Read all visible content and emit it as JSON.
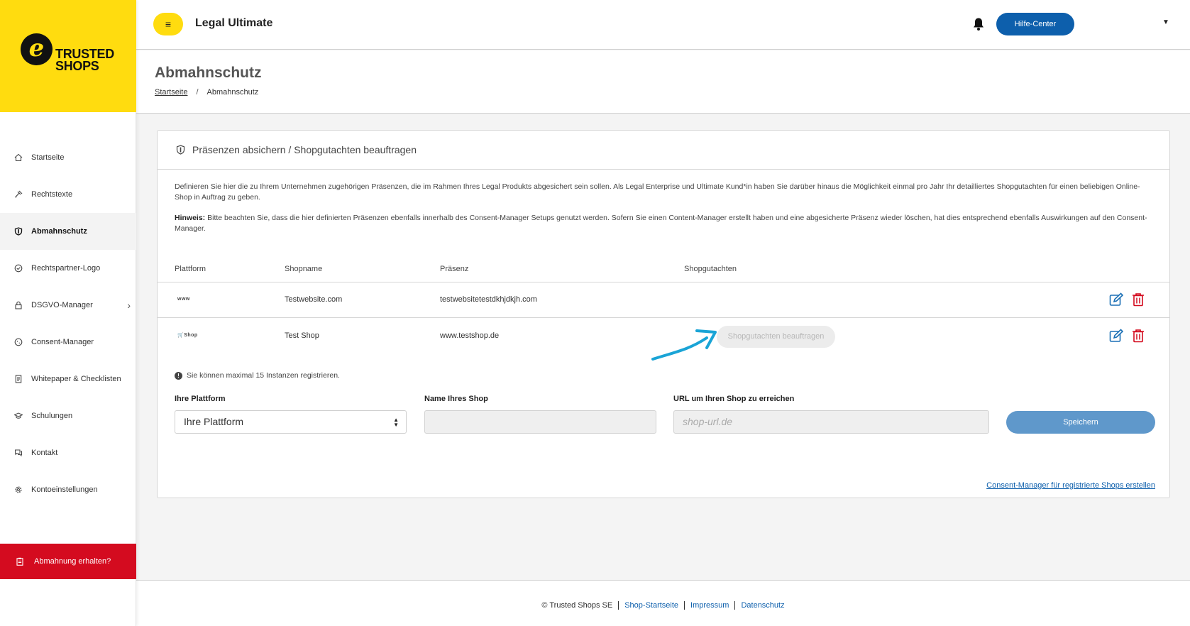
{
  "brand": {
    "logo_line1": "TRUSTED",
    "logo_line2": "SHOPS",
    "logo_mark": "e"
  },
  "sidebar": {
    "items": [
      {
        "label": "Startseite",
        "icon": "home-icon"
      },
      {
        "label": "Rechtstexte",
        "icon": "gavel-icon"
      },
      {
        "label": "Abmahnschutz",
        "icon": "shield-icon",
        "active": true
      },
      {
        "label": "Rechtspartner-Logo",
        "icon": "badge-check-icon"
      },
      {
        "label": "DSGVO-Manager",
        "icon": "lock-icon",
        "has_submenu": true
      },
      {
        "label": "Consent-Manager",
        "icon": "cookie-icon"
      },
      {
        "label": "Whitepaper & Checklisten",
        "icon": "document-icon"
      },
      {
        "label": "Schulungen",
        "icon": "graduation-cap-icon"
      },
      {
        "label": "Kontakt",
        "icon": "chat-icon"
      },
      {
        "label": "Kontoeinstellungen",
        "icon": "gear-icon"
      }
    ],
    "alert_button": "Abmahnung erhalten?"
  },
  "header": {
    "menu_icon": "≡",
    "title": "Legal Ultimate",
    "help_button": "Hilfe-Center"
  },
  "page": {
    "title": "Abmahnschutz",
    "breadcrumb": {
      "home": "Startseite",
      "separator": "/",
      "current": "Abmahnschutz"
    }
  },
  "card": {
    "title": "Präsenzen absichern / Shopgutachten beauftragen",
    "description": "Definieren Sie hier die zu Ihrem Unternehmen zugehörigen Präsenzen, die im Rahmen Ihres Legal Produkts abgesichert sein sollen. Als Legal Enterprise und Ultimate Kund*in haben Sie darüber hinaus die Möglichkeit einmal pro Jahr Ihr detailliertes Shopgutachten für einen beliebigen Online-Shop in Auftrag zu geben.",
    "hint_label": "Hinweis:",
    "hint_text": " Bitte beachten Sie, dass die hier definierten Präsenzen ebenfalls innerhalb des Consent-Manager Setups genutzt werden. Sofern Sie einen Content-Manager erstellt haben und eine abgesicherte Präsenz wieder löschen, hat dies entsprechend ebenfalls Auswirkungen auf den Consent-Manager.",
    "table": {
      "headers": {
        "platform": "Plattform",
        "shopname": "Shopname",
        "presence": "Präsenz",
        "review": "Shopgutachten"
      },
      "rows": [
        {
          "platform": "www",
          "shopname": "Testwebsite.com",
          "presence": "testwebsitetestdkhjdkjh.com",
          "review_button": ""
        },
        {
          "platform": "🛒Shop",
          "shopname": "Test Shop",
          "presence": "www.testshop.de",
          "review_button": "Shopgutachten beauftragen"
        }
      ]
    },
    "limit_note": "Sie können maximal 15 Instanzen registrieren.",
    "form": {
      "platform_label": "Ihre Plattform",
      "platform_value": "Ihre Plattform",
      "shopname_label": "Name Ihres Shop",
      "shopname_value": "",
      "url_label": "URL um Ihren Shop zu erreichen",
      "url_placeholder": "shop-url.de",
      "save_button": "Speichern"
    },
    "consent_link": "Consent-Manager für registrierte Shops erstellen"
  },
  "footer": {
    "copyright": "© Trusted Shops SE",
    "links": [
      "Shop-Startseite",
      "Impressum",
      "Datenschutz"
    ]
  },
  "colors": {
    "brand_yellow": "#ffdc0f",
    "primary_blue": "#0d5fac",
    "danger_red": "#d40b1f",
    "edit_blue": "#1a6fb5",
    "annotation_arrow": "#1aa4d6"
  }
}
